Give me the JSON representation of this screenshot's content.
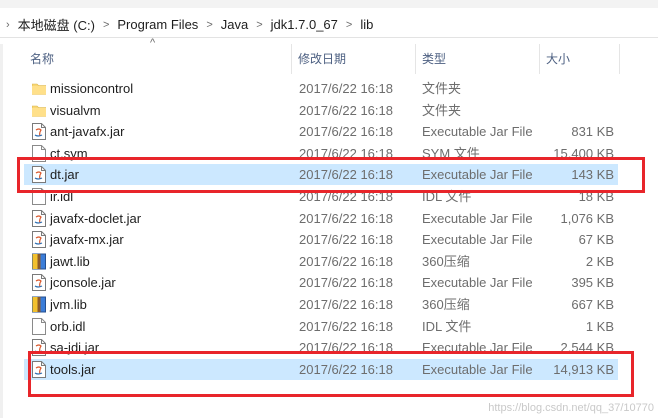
{
  "breadcrumb": {
    "nav_arrow": "›",
    "items": [
      "本地磁盘 (C:)",
      "Program Files",
      "Java",
      "jdk1.7.0_67",
      "lib"
    ],
    "separator": ">"
  },
  "top_cut_text": "...",
  "columns": {
    "name": "名称",
    "date": "修改日期",
    "type": "类型",
    "size": "大小",
    "sort_indicator": "^"
  },
  "files": [
    {
      "name": "missioncontrol",
      "date": "2017/6/22 16:18",
      "type": "文件夹",
      "size": "",
      "icon": "folder-icon"
    },
    {
      "name": "visualvm",
      "date": "2017/6/22 16:18",
      "type": "文件夹",
      "size": "",
      "icon": "folder-icon"
    },
    {
      "name": "ant-javafx.jar",
      "date": "2017/6/22 16:18",
      "type": "Executable Jar File",
      "size": "831 KB",
      "icon": "jar-icon"
    },
    {
      "name": "ct.sym",
      "date": "2017/6/22 16:18",
      "type": "SYM 文件",
      "size": "15,400 KB",
      "icon": "file-icon"
    },
    {
      "name": "dt.jar",
      "date": "2017/6/22 16:18",
      "type": "Executable Jar File",
      "size": "143 KB",
      "icon": "jar-icon",
      "selected": true
    },
    {
      "name": "ir.idl",
      "date": "2017/6/22 16:18",
      "type": "IDL 文件",
      "size": "18 KB",
      "icon": "file-icon"
    },
    {
      "name": "javafx-doclet.jar",
      "date": "2017/6/22 16:18",
      "type": "Executable Jar File",
      "size": "1,076 KB",
      "icon": "jar-icon"
    },
    {
      "name": "javafx-mx.jar",
      "date": "2017/6/22 16:18",
      "type": "Executable Jar File",
      "size": "67 KB",
      "icon": "jar-icon"
    },
    {
      "name": "jawt.lib",
      "date": "2017/6/22 16:18",
      "type": "360压缩",
      "size": "2 KB",
      "icon": "archive-icon"
    },
    {
      "name": "jconsole.jar",
      "date": "2017/6/22 16:18",
      "type": "Executable Jar File",
      "size": "395 KB",
      "icon": "jar-icon"
    },
    {
      "name": "jvm.lib",
      "date": "2017/6/22 16:18",
      "type": "360压缩",
      "size": "667 KB",
      "icon": "archive-icon"
    },
    {
      "name": "orb.idl",
      "date": "2017/6/22 16:18",
      "type": "IDL 文件",
      "size": "1 KB",
      "icon": "file-icon"
    },
    {
      "name": "sa-jdi.jar",
      "date": "2017/6/22 16:18",
      "type": "Executable Jar File",
      "size": "2,544 KB",
      "icon": "jar-icon"
    },
    {
      "name": "tools.jar",
      "date": "2017/6/22 16:18",
      "type": "Executable Jar File",
      "size": "14,913 KB",
      "icon": "jar-icon",
      "selected": true
    }
  ],
  "highlight_color": "#e8252a",
  "selection_color": "#cce8ff",
  "watermark": "https://blog.csdn.net/qq_37/10770"
}
